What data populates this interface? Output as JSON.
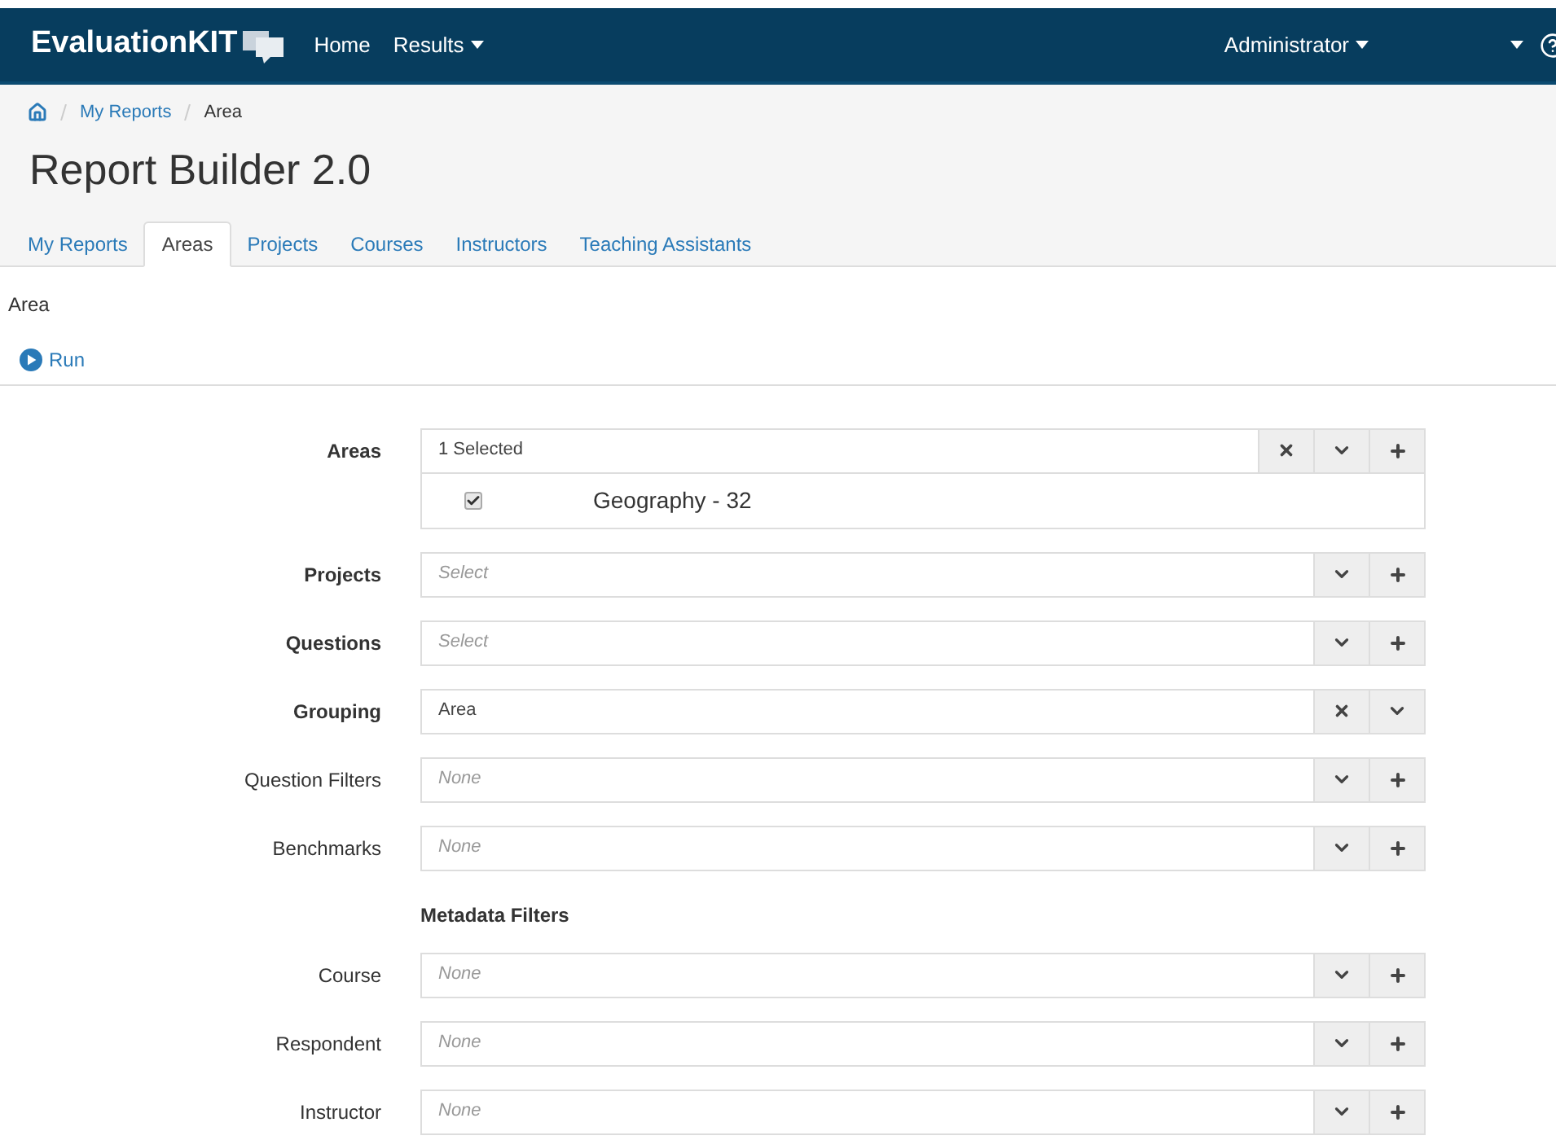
{
  "navbar": {
    "logo": "EvaluationKIT",
    "links": [
      {
        "label": "Home",
        "dropdown": false
      },
      {
        "label": "Results",
        "dropdown": true
      }
    ],
    "user": {
      "label": "Administrator",
      "dropdown": true
    }
  },
  "breadcrumb": [
    "My Reports",
    "Area"
  ],
  "title": "Report Builder 2.0",
  "tabs": [
    {
      "label": "My Reports",
      "selected": false
    },
    {
      "label": "Areas",
      "selected": true
    },
    {
      "label": "Projects",
      "selected": false
    },
    {
      "label": "Courses",
      "selected": false
    },
    {
      "label": "Instructors",
      "selected": false
    },
    {
      "label": "Teaching Assistants",
      "selected": false
    }
  ],
  "section_label": "Area",
  "run_button": "Run",
  "form": [
    {
      "kind": "field",
      "label": "Areas",
      "bold": true,
      "value": "1 Selected",
      "buttons": [
        {
          "kind": "clear"
        },
        {
          "kind": "toggle"
        },
        {
          "kind": "add"
        }
      ],
      "options": [
        {
          "label": "Geography - 32",
          "checked": true
        }
      ]
    },
    {
      "kind": "field",
      "label": "Projects",
      "bold": true,
      "placeholder": "Select",
      "buttons": [
        {
          "kind": "toggle"
        },
        {
          "kind": "add"
        }
      ]
    },
    {
      "kind": "field",
      "label": "Questions",
      "bold": true,
      "placeholder": "Select",
      "buttons": [
        {
          "kind": "toggle"
        },
        {
          "kind": "add"
        }
      ]
    },
    {
      "kind": "field",
      "label": "Grouping",
      "bold": true,
      "value": "Area",
      "buttons": [
        {
          "kind": "clear"
        },
        {
          "kind": "toggle"
        }
      ]
    },
    {
      "kind": "field",
      "label": "Question Filters",
      "bold": false,
      "placeholder": "None",
      "buttons": [
        {
          "kind": "toggle"
        },
        {
          "kind": "add"
        }
      ]
    },
    {
      "kind": "field",
      "label": "Benchmarks",
      "bold": false,
      "placeholder": "None",
      "buttons": [
        {
          "kind": "toggle"
        },
        {
          "kind": "add"
        }
      ]
    },
    {
      "kind": "heading",
      "label": "Metadata Filters"
    },
    {
      "kind": "field",
      "label": "Course",
      "bold": false,
      "placeholder": "None",
      "buttons": [
        {
          "kind": "toggle"
        },
        {
          "kind": "add"
        }
      ]
    },
    {
      "kind": "field",
      "label": "Respondent",
      "bold": false,
      "placeholder": "None",
      "buttons": [
        {
          "kind": "toggle"
        },
        {
          "kind": "add"
        }
      ]
    },
    {
      "kind": "field",
      "label": "Instructor",
      "bold": false,
      "placeholder": "None",
      "buttons": [
        {
          "kind": "toggle"
        },
        {
          "kind": "add"
        }
      ]
    }
  ]
}
